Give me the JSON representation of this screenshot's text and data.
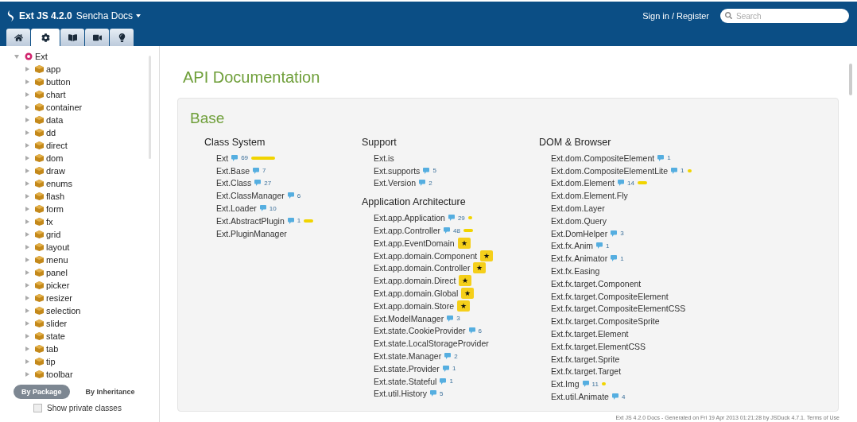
{
  "header": {
    "product": "Ext JS 4.2.0",
    "site": "Sencha Docs",
    "sign_in": "Sign in / Register",
    "search": {
      "placeholder": "Search"
    }
  },
  "nav_tabs": [
    {
      "kind": "home",
      "selected": false
    },
    {
      "kind": "gear",
      "selected": true
    },
    {
      "kind": "book",
      "selected": false
    },
    {
      "kind": "video",
      "selected": false
    },
    {
      "kind": "bulb",
      "selected": false
    }
  ],
  "tree": [
    {
      "label": "Ext",
      "kind": "root",
      "expanded": true,
      "children": [
        {
          "label": "app",
          "expanded": false
        },
        {
          "label": "button",
          "expanded": false
        },
        {
          "label": "chart",
          "expanded": false
        },
        {
          "label": "container",
          "expanded": false
        },
        {
          "label": "data",
          "expanded": false
        },
        {
          "label": "dd",
          "expanded": false
        },
        {
          "label": "direct",
          "expanded": false
        },
        {
          "label": "dom",
          "expanded": false
        },
        {
          "label": "draw",
          "expanded": false
        },
        {
          "label": "enums",
          "expanded": false
        },
        {
          "label": "flash",
          "expanded": false
        },
        {
          "label": "form",
          "expanded": false
        },
        {
          "label": "fx",
          "expanded": false
        },
        {
          "label": "grid",
          "expanded": false
        },
        {
          "label": "layout",
          "expanded": false
        },
        {
          "label": "menu",
          "expanded": false
        },
        {
          "label": "panel",
          "expanded": false
        },
        {
          "label": "picker",
          "expanded": false
        },
        {
          "label": "resizer",
          "expanded": false
        },
        {
          "label": "selection",
          "expanded": false
        },
        {
          "label": "slider",
          "expanded": false
        },
        {
          "label": "state",
          "expanded": false
        },
        {
          "label": "tab",
          "expanded": false
        },
        {
          "label": "tip",
          "expanded": false
        },
        {
          "label": "toolbar",
          "expanded": false
        }
      ]
    }
  ],
  "view_toggle": [
    {
      "label": "By Package",
      "selected": true
    },
    {
      "label": "By Inheritance",
      "selected": false
    }
  ],
  "private_classes": {
    "label": "Show private classes",
    "checked": false
  },
  "page_title": "API Documentation",
  "section": {
    "title": "Base",
    "columns": [
      {
        "groups": [
          {
            "title": "Class System",
            "items": [
              {
                "name": "Ext",
                "count": "69",
                "kind": "long"
              },
              {
                "name": "Ext.Base",
                "count": "7"
              },
              {
                "name": "Ext.Class",
                "count": "27"
              },
              {
                "name": "Ext.ClassManager",
                "count": "6"
              },
              {
                "name": "Ext.Loader",
                "count": "10"
              },
              {
                "name": "Ext.AbstractPlugin",
                "count": "1",
                "kind": "mid"
              },
              {
                "name": "Ext.PluginManager"
              }
            ]
          }
        ]
      },
      {
        "groups": [
          {
            "title": "Support",
            "items": [
              {
                "name": "Ext.is"
              },
              {
                "name": "Ext.supports",
                "count": "5"
              },
              {
                "name": "Ext.Version",
                "count": "2"
              }
            ]
          },
          {
            "title": "Application Architecture",
            "items": [
              {
                "name": "Ext.app.Application",
                "count": "29",
                "kind": "dot"
              },
              {
                "name": "Ext.app.Controller",
                "count": "48",
                "kind": "mid"
              },
              {
                "name": "Ext.app.EventDomain",
                "kind": "star",
                "badge": "★"
              },
              {
                "name": "Ext.app.domain.Component",
                "kind": "star",
                "badge": "★"
              },
              {
                "name": "Ext.app.domain.Controller",
                "kind": "star",
                "badge": "★"
              },
              {
                "name": "Ext.app.domain.Direct",
                "kind": "star",
                "badge": "★"
              },
              {
                "name": "Ext.app.domain.Global",
                "kind": "star",
                "badge": "★"
              },
              {
                "name": "Ext.app.domain.Store",
                "kind": "star",
                "badge": "★"
              },
              {
                "name": "Ext.ModelManager",
                "count": "3"
              },
              {
                "name": "Ext.state.CookieProvider",
                "count": "6"
              },
              {
                "name": "Ext.state.LocalStorageProvider"
              },
              {
                "name": "Ext.state.Manager",
                "count": "2"
              },
              {
                "name": "Ext.state.Provider",
                "count": "1"
              },
              {
                "name": "Ext.state.Stateful",
                "count": "1"
              },
              {
                "name": "Ext.util.History",
                "count": "5"
              }
            ]
          }
        ]
      },
      {
        "groups": [
          {
            "title": "DOM & Browser",
            "items": [
              {
                "name": "Ext.dom.CompositeElement",
                "count": "1"
              },
              {
                "name": "Ext.dom.CompositeElementLite",
                "count": "1",
                "kind": "dot"
              },
              {
                "name": "Ext.dom.Element",
                "count": "14",
                "kind": "mid"
              },
              {
                "name": "Ext.dom.Element.Fly"
              },
              {
                "name": "Ext.dom.Layer"
              },
              {
                "name": "Ext.dom.Query"
              },
              {
                "name": "Ext.DomHelper",
                "count": "3"
              },
              {
                "name": "Ext.fx.Anim",
                "count": "1"
              },
              {
                "name": "Ext.fx.Animator",
                "count": "1"
              },
              {
                "name": "Ext.fx.Easing"
              },
              {
                "name": "Ext.fx.target.Component"
              },
              {
                "name": "Ext.fx.target.CompositeElement"
              },
              {
                "name": "Ext.fx.target.CompositeElementCSS"
              },
              {
                "name": "Ext.fx.target.CompositeSprite"
              },
              {
                "name": "Ext.fx.target.Element"
              },
              {
                "name": "Ext.fx.target.ElementCSS"
              },
              {
                "name": "Ext.fx.target.Sprite"
              },
              {
                "name": "Ext.fx.target.Target"
              },
              {
                "name": "Ext.Img",
                "count": "11",
                "kind": "dot"
              },
              {
                "name": "Ext.util.Animate",
                "count": "4"
              }
            ]
          }
        ]
      }
    ]
  },
  "footer": "Ext JS 4.2.0 Docs - Generated on Fri 19 Apr 2013 01:21:28 by JSDuck 4.7.1. Terms of Use"
}
